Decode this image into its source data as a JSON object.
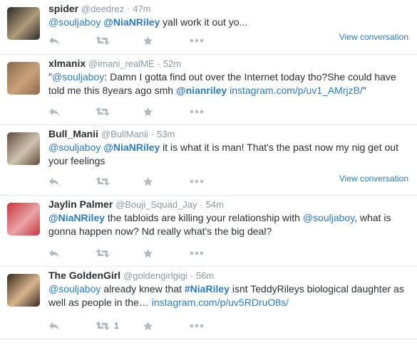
{
  "tweets": [
    {
      "fullname": "spider",
      "username": "@deedrez",
      "sep": "·",
      "time": "47m",
      "parts": [
        {
          "t": "@souljaboy",
          "link": true
        },
        {
          "t": " ",
          "link": false
        },
        {
          "t": "@NiaNRiley",
          "link": true,
          "bold": true
        },
        {
          "t": " yall  work  it out  yo...",
          "link": false
        }
      ],
      "view_conversation": "View conversation",
      "retweet_count": "",
      "avatar_colors": [
        "#2a2a2a",
        "#b09a78"
      ]
    },
    {
      "fullname": "xlmanix",
      "username": "@imani_realME",
      "sep": "·",
      "time": "52m",
      "parts": [
        {
          "t": "\"",
          "link": false
        },
        {
          "t": "@souljaboy",
          "link": true
        },
        {
          "t": ": Damn I gotta find out over the Internet today tho?She could have told me this 8years ago smh ",
          "link": false
        },
        {
          "t": "@nianriley",
          "link": true,
          "bold": true
        },
        {
          "t": " ",
          "link": false
        },
        {
          "t": "instagram.com/p/uv1_AMrjzB/",
          "link": true
        },
        {
          "t": "\"",
          "link": false
        }
      ],
      "view_conversation": "",
      "retweet_count": "",
      "avatar_colors": [
        "#8a6a4c",
        "#c9a27a"
      ]
    },
    {
      "fullname": "Bull_Manii",
      "username": "@BullManii",
      "sep": "·",
      "time": "53m",
      "parts": [
        {
          "t": "@souljaboy",
          "link": true
        },
        {
          "t": " ",
          "link": false
        },
        {
          "t": "@NiaNRiley",
          "link": true,
          "bold": true
        },
        {
          "t": "  it is what it is man! That's the past now my nig get out your feelings",
          "link": false
        }
      ],
      "view_conversation": "View conversation",
      "retweet_count": "",
      "avatar_colors": [
        "#5d4a3a",
        "#cfc3b0"
      ]
    },
    {
      "fullname": "Jaylin Palmer",
      "username": "@Bouji_Squad_Jay",
      "sep": "·",
      "time": "54m",
      "parts": [
        {
          "t": "@NiaNRiley",
          "link": true,
          "bold": true
        },
        {
          "t": " the tabloids are killing your relationship with ",
          "link": false
        },
        {
          "t": "@souljaboy",
          "link": true
        },
        {
          "t": ", what is gonna happen now? Nd really what's the big deal?",
          "link": false
        }
      ],
      "view_conversation": "",
      "retweet_count": "",
      "avatar_colors": [
        "#c8343a",
        "#e8a4a6"
      ]
    },
    {
      "fullname": "The GoldenGirl",
      "username": "@goldengirlgigi",
      "sep": "·",
      "time": "56m",
      "parts": [
        {
          "t": "@souljaboy",
          "link": true
        },
        {
          "t": " already knew that ",
          "link": false
        },
        {
          "t": "#NiaRiley",
          "link": true,
          "bold": true
        },
        {
          "t": " isnt TeddyRileys biological daughter as well as people in the… ",
          "link": false
        },
        {
          "t": "instagram.com/p/uv5RDruO8s/",
          "link": true
        }
      ],
      "view_conversation": "",
      "retweet_count": "1",
      "avatar_colors": [
        "#3a2a22",
        "#d8b48c"
      ]
    }
  ],
  "icons": {
    "reply": "reply-icon",
    "retweet": "retweet-icon",
    "favorite": "star-icon",
    "more": "more-icon"
  }
}
